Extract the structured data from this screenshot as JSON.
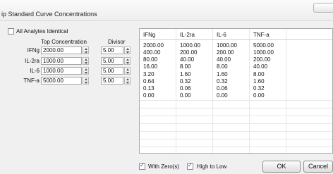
{
  "window": {
    "title": "ip Standard Curve Concentrations"
  },
  "left_panel": {
    "all_identical_label": "All Analytes Identical",
    "all_identical_checked": false,
    "top_conc_header": "Top Concentration",
    "divisor_header": "Divisor",
    "analytes": [
      {
        "label": "IFNg",
        "top": "2000.00",
        "divisor": "5.00"
      },
      {
        "label": "IL-2ra",
        "top": "1000.00",
        "divisor": "5.00"
      },
      {
        "label": "IL-6",
        "top": "1000.00",
        "divisor": "5.00"
      },
      {
        "label": "TNF-a",
        "top": "5000.00",
        "divisor": "5.00"
      }
    ]
  },
  "grid": {
    "columns": [
      "IFNg",
      "IL-2ra",
      "IL-6",
      "TNF-a"
    ],
    "rows": [
      [
        "2000.00",
        "1000.00",
        "1000.00",
        "5000.00"
      ],
      [
        "400.00",
        "200.00",
        "200.00",
        "1000.00"
      ],
      [
        "80.00",
        "40.00",
        "40.00",
        "200.00"
      ],
      [
        "16.00",
        "8.00",
        "8.00",
        "40.00"
      ],
      [
        "3.20",
        "1.60",
        "1.60",
        "8.00"
      ],
      [
        "0.64",
        "0.32",
        "0.32",
        "1.60"
      ],
      [
        "0.13",
        "0.06",
        "0.06",
        "0.32"
      ],
      [
        "0.00",
        "0.00",
        "0.00",
        "0.00"
      ]
    ]
  },
  "bottom": {
    "with_zero_label": "With Zero(s)",
    "with_zero_checked": true,
    "high_to_low_label": "High to Low",
    "high_to_low_checked": true,
    "ok_label": "OK",
    "cancel_label": "Cancel"
  }
}
